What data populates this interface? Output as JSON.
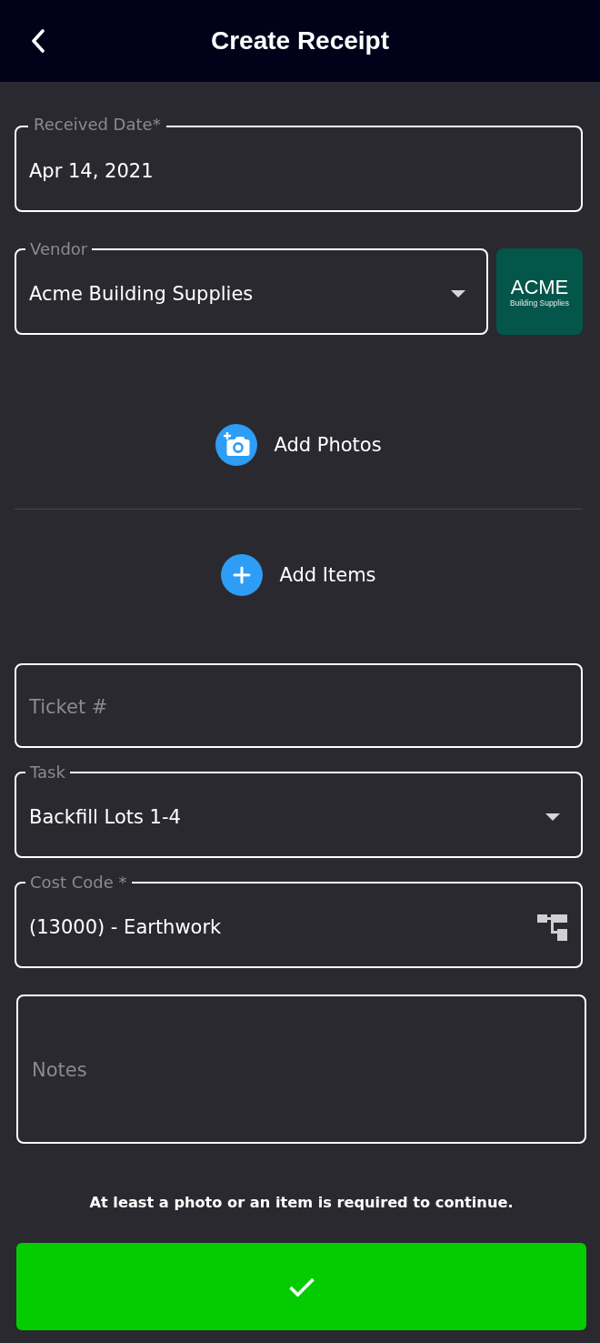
{
  "header": {
    "title": "Create Receipt"
  },
  "fields": [
    {
      "kind": "text",
      "label": "Received Date*",
      "value": "Apr 14, 2021"
    },
    {
      "kind": "dropdown",
      "label": "Vendor",
      "value": "Acme Building Supplies",
      "logo": {
        "title": "ACME",
        "subtitle": "Building Supplies"
      }
    }
  ],
  "actions": [
    {
      "kind": "photo",
      "label": "Add Photos"
    },
    {
      "kind": "add",
      "label": "Add Items"
    }
  ],
  "details": [
    {
      "kind": "text",
      "placeholder": "Ticket #"
    },
    {
      "kind": "dropdown",
      "label": "Task",
      "value": "Backfill Lots 1-4"
    },
    {
      "kind": "picker",
      "label": "Cost Code *",
      "value": "(13000) - Earthwork"
    },
    {
      "kind": "notes",
      "placeholder": "Notes"
    }
  ],
  "notice": "At least a photo or an item is required to continue."
}
